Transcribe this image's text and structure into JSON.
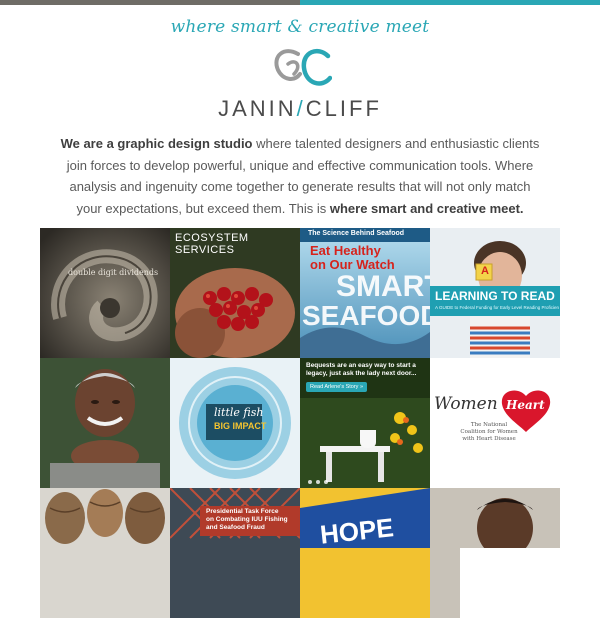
{
  "header": {
    "tagline": "where smart & creative meet",
    "brand_left": "JANIN",
    "brand_sep": "/",
    "brand_right": "CLIFF"
  },
  "intro": {
    "bold_lead": "We are a graphic design studio",
    "body": " where talented designers and enthusiastic clients join forces to develop powerful, unique and effective communication tools. Where analysis and ingenuity come together to generate results that will not only match your expectations, but exceed them. This is ",
    "bold_tail": "where smart and creative meet."
  },
  "portfolio": {
    "t1": {
      "caption": "double digit dividends"
    },
    "t2": {
      "line1": "ECOSYSTEM",
      "line2": "SERVICES"
    },
    "t3": {
      "kicker": "The Science Behind Seafood",
      "line1": "Eat Healthy",
      "line2": "on Our Watch",
      "big1": "SMART",
      "big2": "SEAFOOD"
    },
    "t4": {
      "block": "A",
      "title": "LEARNING TO READ",
      "sub": "A GUIDE to Federal Funding for Early Level Reading Proficiency"
    },
    "t6": {
      "line1": "little fish",
      "line2": "BIG IMPACT"
    },
    "t7": {
      "line1": "Bequests are an easy way to start a",
      "line2": "legacy, just ask the lady next door...",
      "button": "Read Arlene's Story »"
    },
    "t8": {
      "women": "Women",
      "heart": "Heart",
      "sub1": "The National",
      "sub2": "Coalition for Women",
      "sub3": "with Heart Disease"
    },
    "t10": {
      "line1": "Presidential Task Force",
      "line2": "on Combating IUU Fishing",
      "line3": "and Seafood Fraud"
    },
    "t11": {
      "word": "HOPE"
    }
  },
  "colors": {
    "accent": "#2aa7b5",
    "bar_gray": "#6f6c66",
    "text": "#5a5a5a"
  }
}
